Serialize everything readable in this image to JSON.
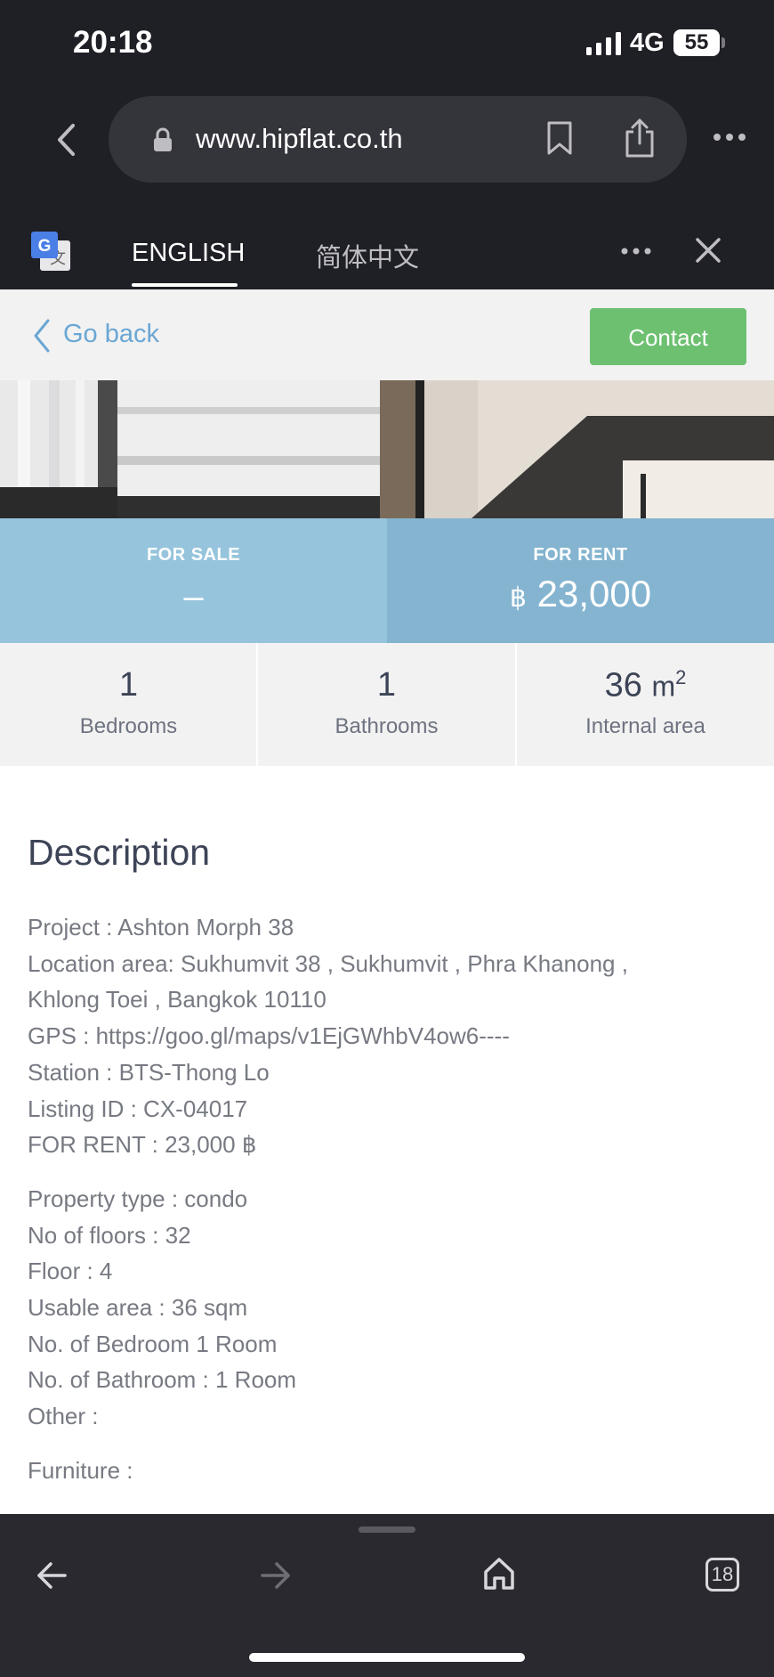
{
  "status_bar": {
    "time": "20:18",
    "network": "4G",
    "battery": "55"
  },
  "browser": {
    "url": "www.hipflat.co.th"
  },
  "translate_bar": {
    "tab_english": "ENGLISH",
    "tab_chinese": "简体中文"
  },
  "page_header": {
    "go_back": "Go back",
    "contact": "Contact"
  },
  "price": {
    "sale_label": "FOR SALE",
    "sale_value": "–",
    "rent_label": "FOR RENT",
    "rent_currency": "฿",
    "rent_value": "23,000"
  },
  "stats": {
    "bedrooms_value": "1",
    "bedrooms_label": "Bedrooms",
    "bathrooms_value": "1",
    "bathrooms_label": "Bathrooms",
    "area_value": "36",
    "area_unit": "m",
    "area_unit_sup": "2",
    "area_label": "Internal area"
  },
  "description": {
    "title": "Description",
    "lines_a": [
      "Project : Ashton Morph 38",
      "Location area: Sukhumvit 38 , Sukhumvit , Phra Khanong ,",
      "Khlong Toei , Bangkok 10110",
      "GPS : https://goo.gl/maps/v1EjGWhbV4ow6----",
      "Station : BTS-Thong Lo",
      "Listing ID : CX-04017",
      "FOR RENT : 23,000 ฿"
    ],
    "lines_b": [
      "Property type : condo",
      "No of floors : 32",
      "Floor : 4",
      "Usable area : 36 sqm",
      "No. of Bedroom 1 Room",
      "No. of Bathroom : 1 Room",
      "Other :"
    ],
    "lines_c": [
      "Furniture :"
    ]
  },
  "toolbar": {
    "tab_count": "18"
  }
}
